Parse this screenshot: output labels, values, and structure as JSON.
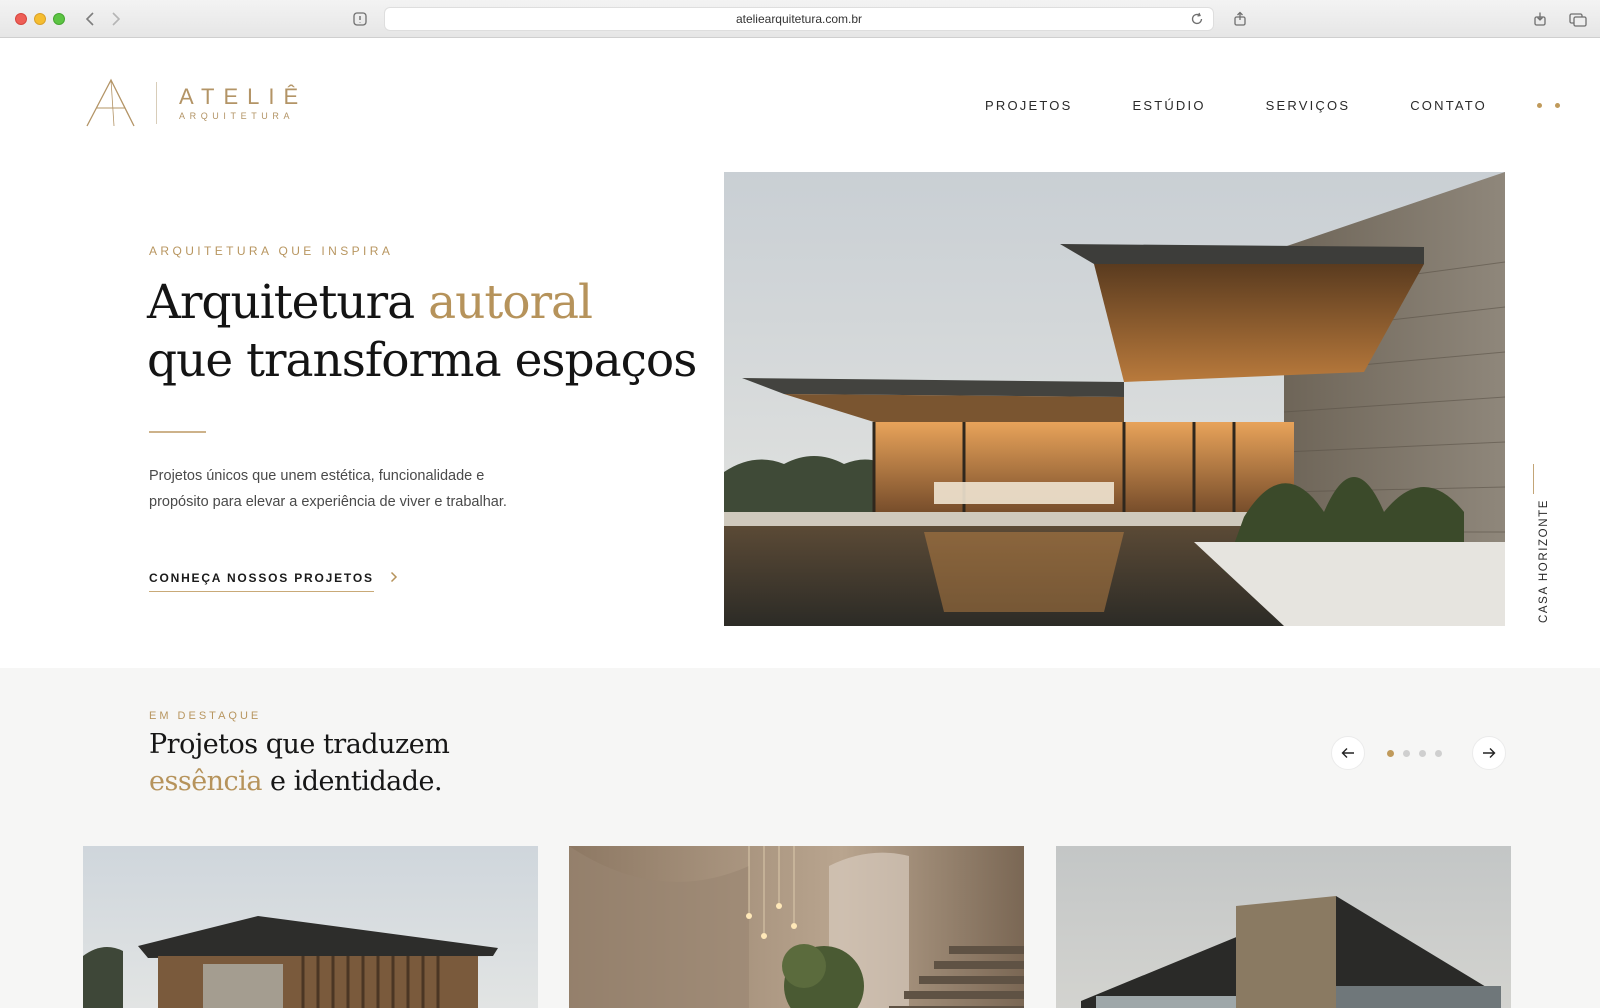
{
  "browser": {
    "url": "ateliearquitetura.com.br"
  },
  "brand": {
    "name": "ATELIÊ",
    "tagline": "ARQUITETURA",
    "accent": "#b6935b"
  },
  "nav": {
    "items": [
      {
        "label": "PROJETOS"
      },
      {
        "label": "ESTÚDIO"
      },
      {
        "label": "SERVIÇOS"
      },
      {
        "label": "CONTATO"
      }
    ]
  },
  "hero": {
    "eyebrow": "ARQUITETURA QUE INSPIRA",
    "title_part1": "Arquitetura ",
    "title_highlight": "autoral",
    "title_line2": "que transforma espaços",
    "body": "Projetos únicos que unem estética, funcionalidade e propósito para elevar a experiência de viver e trabalhar.",
    "cta_label": "CONHEÇA NOSSOS PROJETOS",
    "image_caption": "CASA HORIZONTE"
  },
  "featured": {
    "eyebrow": "EM DESTAQUE",
    "title_line1": "Projetos que traduzem",
    "title_highlight": "essência",
    "title_rest": " e identidade.",
    "carousel": {
      "slide_count": 4,
      "active_index": 0
    }
  }
}
